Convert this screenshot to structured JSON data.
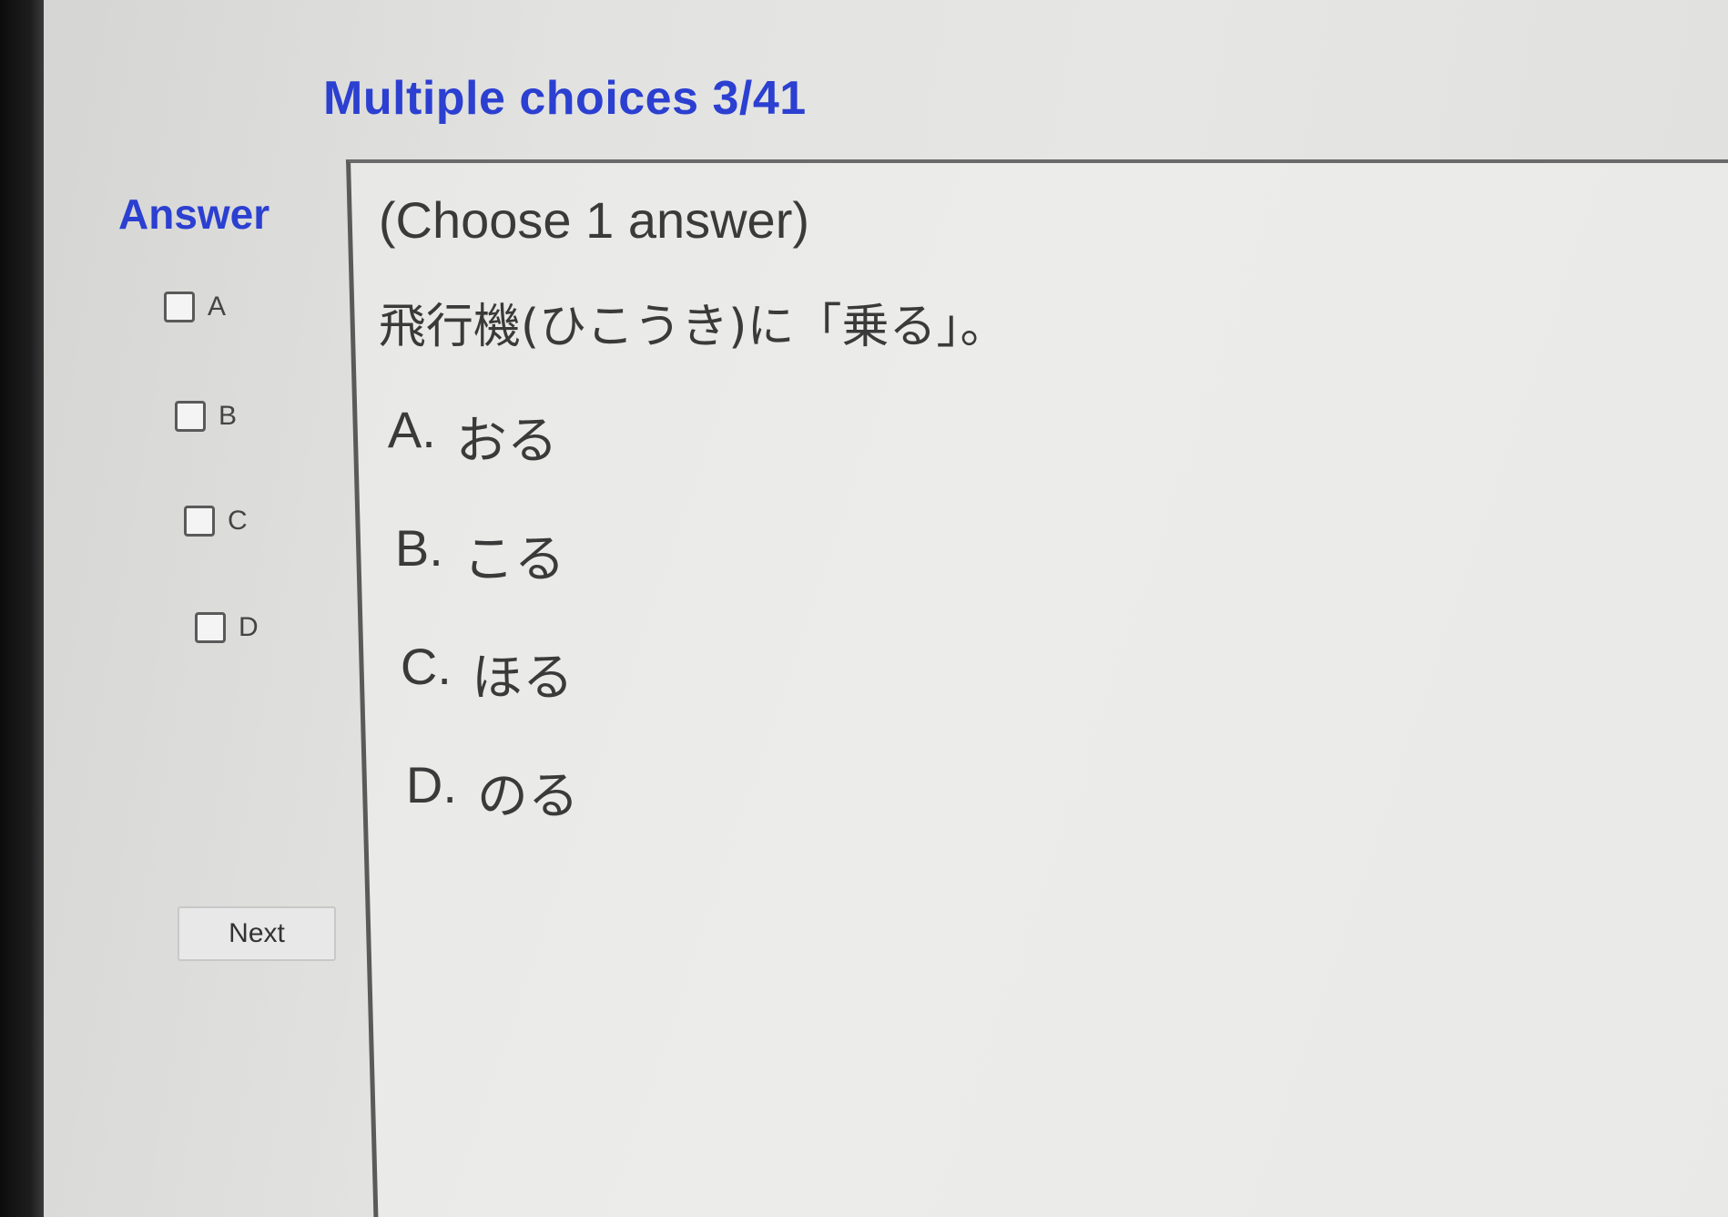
{
  "header": {
    "title": "Multiple choices 3/41"
  },
  "answer_panel": {
    "heading": "Answer",
    "choices": [
      {
        "letter": "A"
      },
      {
        "letter": "B"
      },
      {
        "letter": "C"
      },
      {
        "letter": "D"
      }
    ],
    "next_label": "Next"
  },
  "question": {
    "instruction": "(Choose 1 answer)",
    "text": "飛行機(ひこうき)に「乗る」。",
    "options": [
      {
        "letter": "A.",
        "text": "おる"
      },
      {
        "letter": "B.",
        "text": "こる"
      },
      {
        "letter": "C.",
        "text": "ほる"
      },
      {
        "letter": "D.",
        "text": "のる"
      }
    ]
  },
  "colors": {
    "accent_blue": "#2b3fd1",
    "text_gray": "#3a3a3a"
  }
}
